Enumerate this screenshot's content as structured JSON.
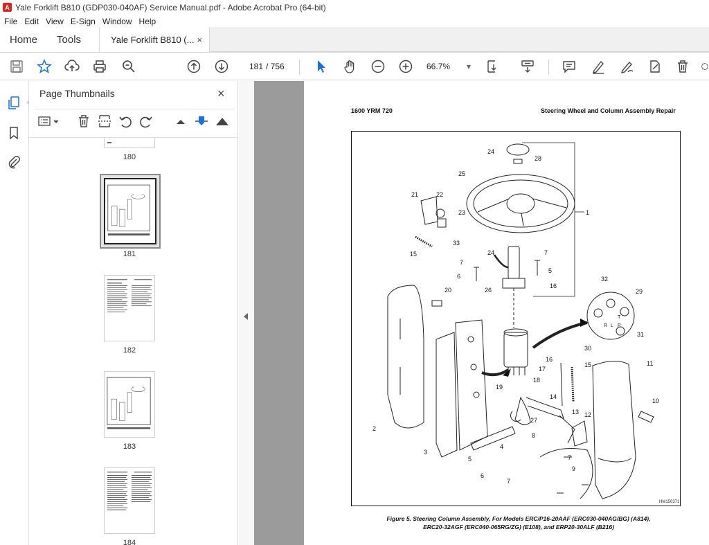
{
  "window": {
    "title": "Yale Forklift B810 (GDP030-040AF) Service Manual.pdf - Adobe Acrobat Pro (64-bit)",
    "app_icon_glyph": "A"
  },
  "menu": [
    "File",
    "Edit",
    "View",
    "E-Sign",
    "Window",
    "Help"
  ],
  "tabs": {
    "home": "Home",
    "tools": "Tools",
    "doc": "Yale Forklift B810 (...",
    "doc_close": "×"
  },
  "toolbar": {
    "current_page": "181",
    "page_sep": "/ 756",
    "zoom": "66.7%",
    "zoom_caret": "▾"
  },
  "thumbnails": {
    "title": "Page Thumbnails",
    "close": "×",
    "pages": [
      {
        "label": "180"
      },
      {
        "label": "181"
      },
      {
        "label": "182"
      },
      {
        "label": "183"
      },
      {
        "label": "184"
      }
    ]
  },
  "document": {
    "header_left": "1600 YRM 720",
    "header_right": "Steering Wheel and Column Assembly Repair",
    "figure_id": "HM150371",
    "caption_line1": "Figure 5.  Steering Column Assembly, For Models ERC/P16-20AAF (ERC030-040AG/BG) (A814),",
    "caption_line2": "ERC20-32AGF (ERC040-065RG/ZG) (E108), and ERP20-30ALF (B216)",
    "callouts": [
      "24",
      "28",
      "25",
      "21",
      "22",
      "1",
      "23",
      "33",
      "24",
      "7",
      "15",
      "7",
      "5",
      "6",
      "16",
      "26",
      "20",
      "32",
      "29",
      "31",
      "30",
      "19",
      "16",
      "15",
      "11",
      "17",
      "18",
      "14",
      "13",
      "10",
      "27",
      "12",
      "2",
      "4",
      "8",
      "3",
      "5",
      "7",
      "6",
      "7",
      "9"
    ],
    "wheel_letters": [
      "R",
      "L",
      "T",
      "P"
    ]
  },
  "colors": {
    "accent_blue": "#1473e6",
    "doc_bg": "#9b9b9b"
  }
}
